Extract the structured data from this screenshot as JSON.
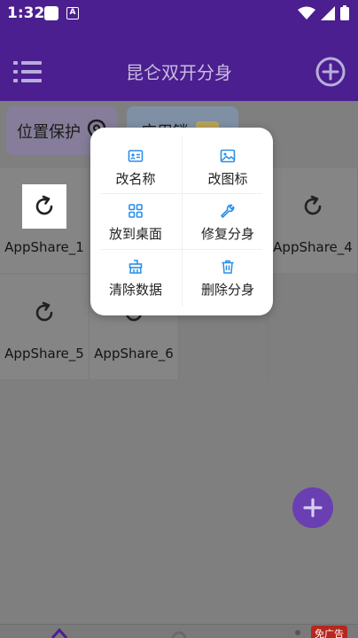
{
  "status": {
    "time": "1:32",
    "a_badge": "A"
  },
  "appbar": {
    "title": "昆仑双开分身"
  },
  "tags": {
    "location": "位置保护",
    "lock": "应用锁"
  },
  "apps": [
    {
      "label": "AppShare_1"
    },
    {
      "label": "AppShare_4"
    },
    {
      "label": "AppShare_5"
    },
    {
      "label": "AppShare_6"
    }
  ],
  "popup": {
    "rename": "改名称",
    "change_icon": "改图标",
    "desktop": "放到桌面",
    "repair": "修复分身",
    "clear": "清除数据",
    "delete": "删除分身"
  },
  "ad": {
    "label": "免广告"
  },
  "colors": {
    "primary": "#4b1f8f",
    "accent": "#6a3fb2",
    "icon_blue": "#2a8ee8"
  }
}
